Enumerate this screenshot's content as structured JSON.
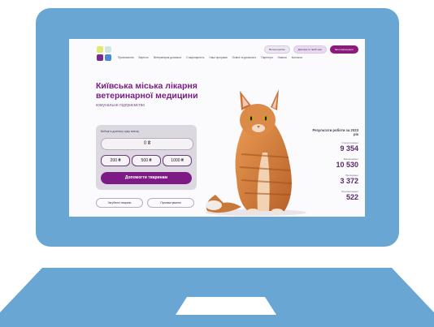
{
  "header": {
    "top_buttons": [
      "Волонтерство",
      "Допомогти твоїй зоні",
      "Зателефонувати"
    ]
  },
  "nav": {
    "items": [
      "Призначення",
      "Вартість",
      "Ветеринарна допомога",
      "Стаціонарність",
      "Наші програми",
      "Освіта та діяльність",
      "Партнери",
      "Новини",
      "Контакти"
    ]
  },
  "hero": {
    "title": "Київська міська лікарня ветеринарної медицини",
    "subtitle": "комунальне підприємство"
  },
  "donate": {
    "label": "Виберіть довільну суму внеску",
    "amount": "0 ₴",
    "presets": [
      "200 ₴",
      "500 ₴",
      "1000 ₴"
    ],
    "button": "Допомогти тваринам"
  },
  "secondary": {
    "left": "Загублені тварини",
    "right": "Прилаштування"
  },
  "stats": {
    "title": "Результати роботи за 2023 рік",
    "items": [
      {
        "label": "Стерилізовано",
        "value": "9 354"
      },
      {
        "label": "Вакциновано",
        "value": "10 530"
      },
      {
        "label": "Вилікувано",
        "value": "3 372"
      },
      {
        "label": "Прилаштовано",
        "value": "522"
      }
    ]
  },
  "colors": {
    "bezel": "#6aa6d4",
    "accent": "#7d1a86"
  }
}
